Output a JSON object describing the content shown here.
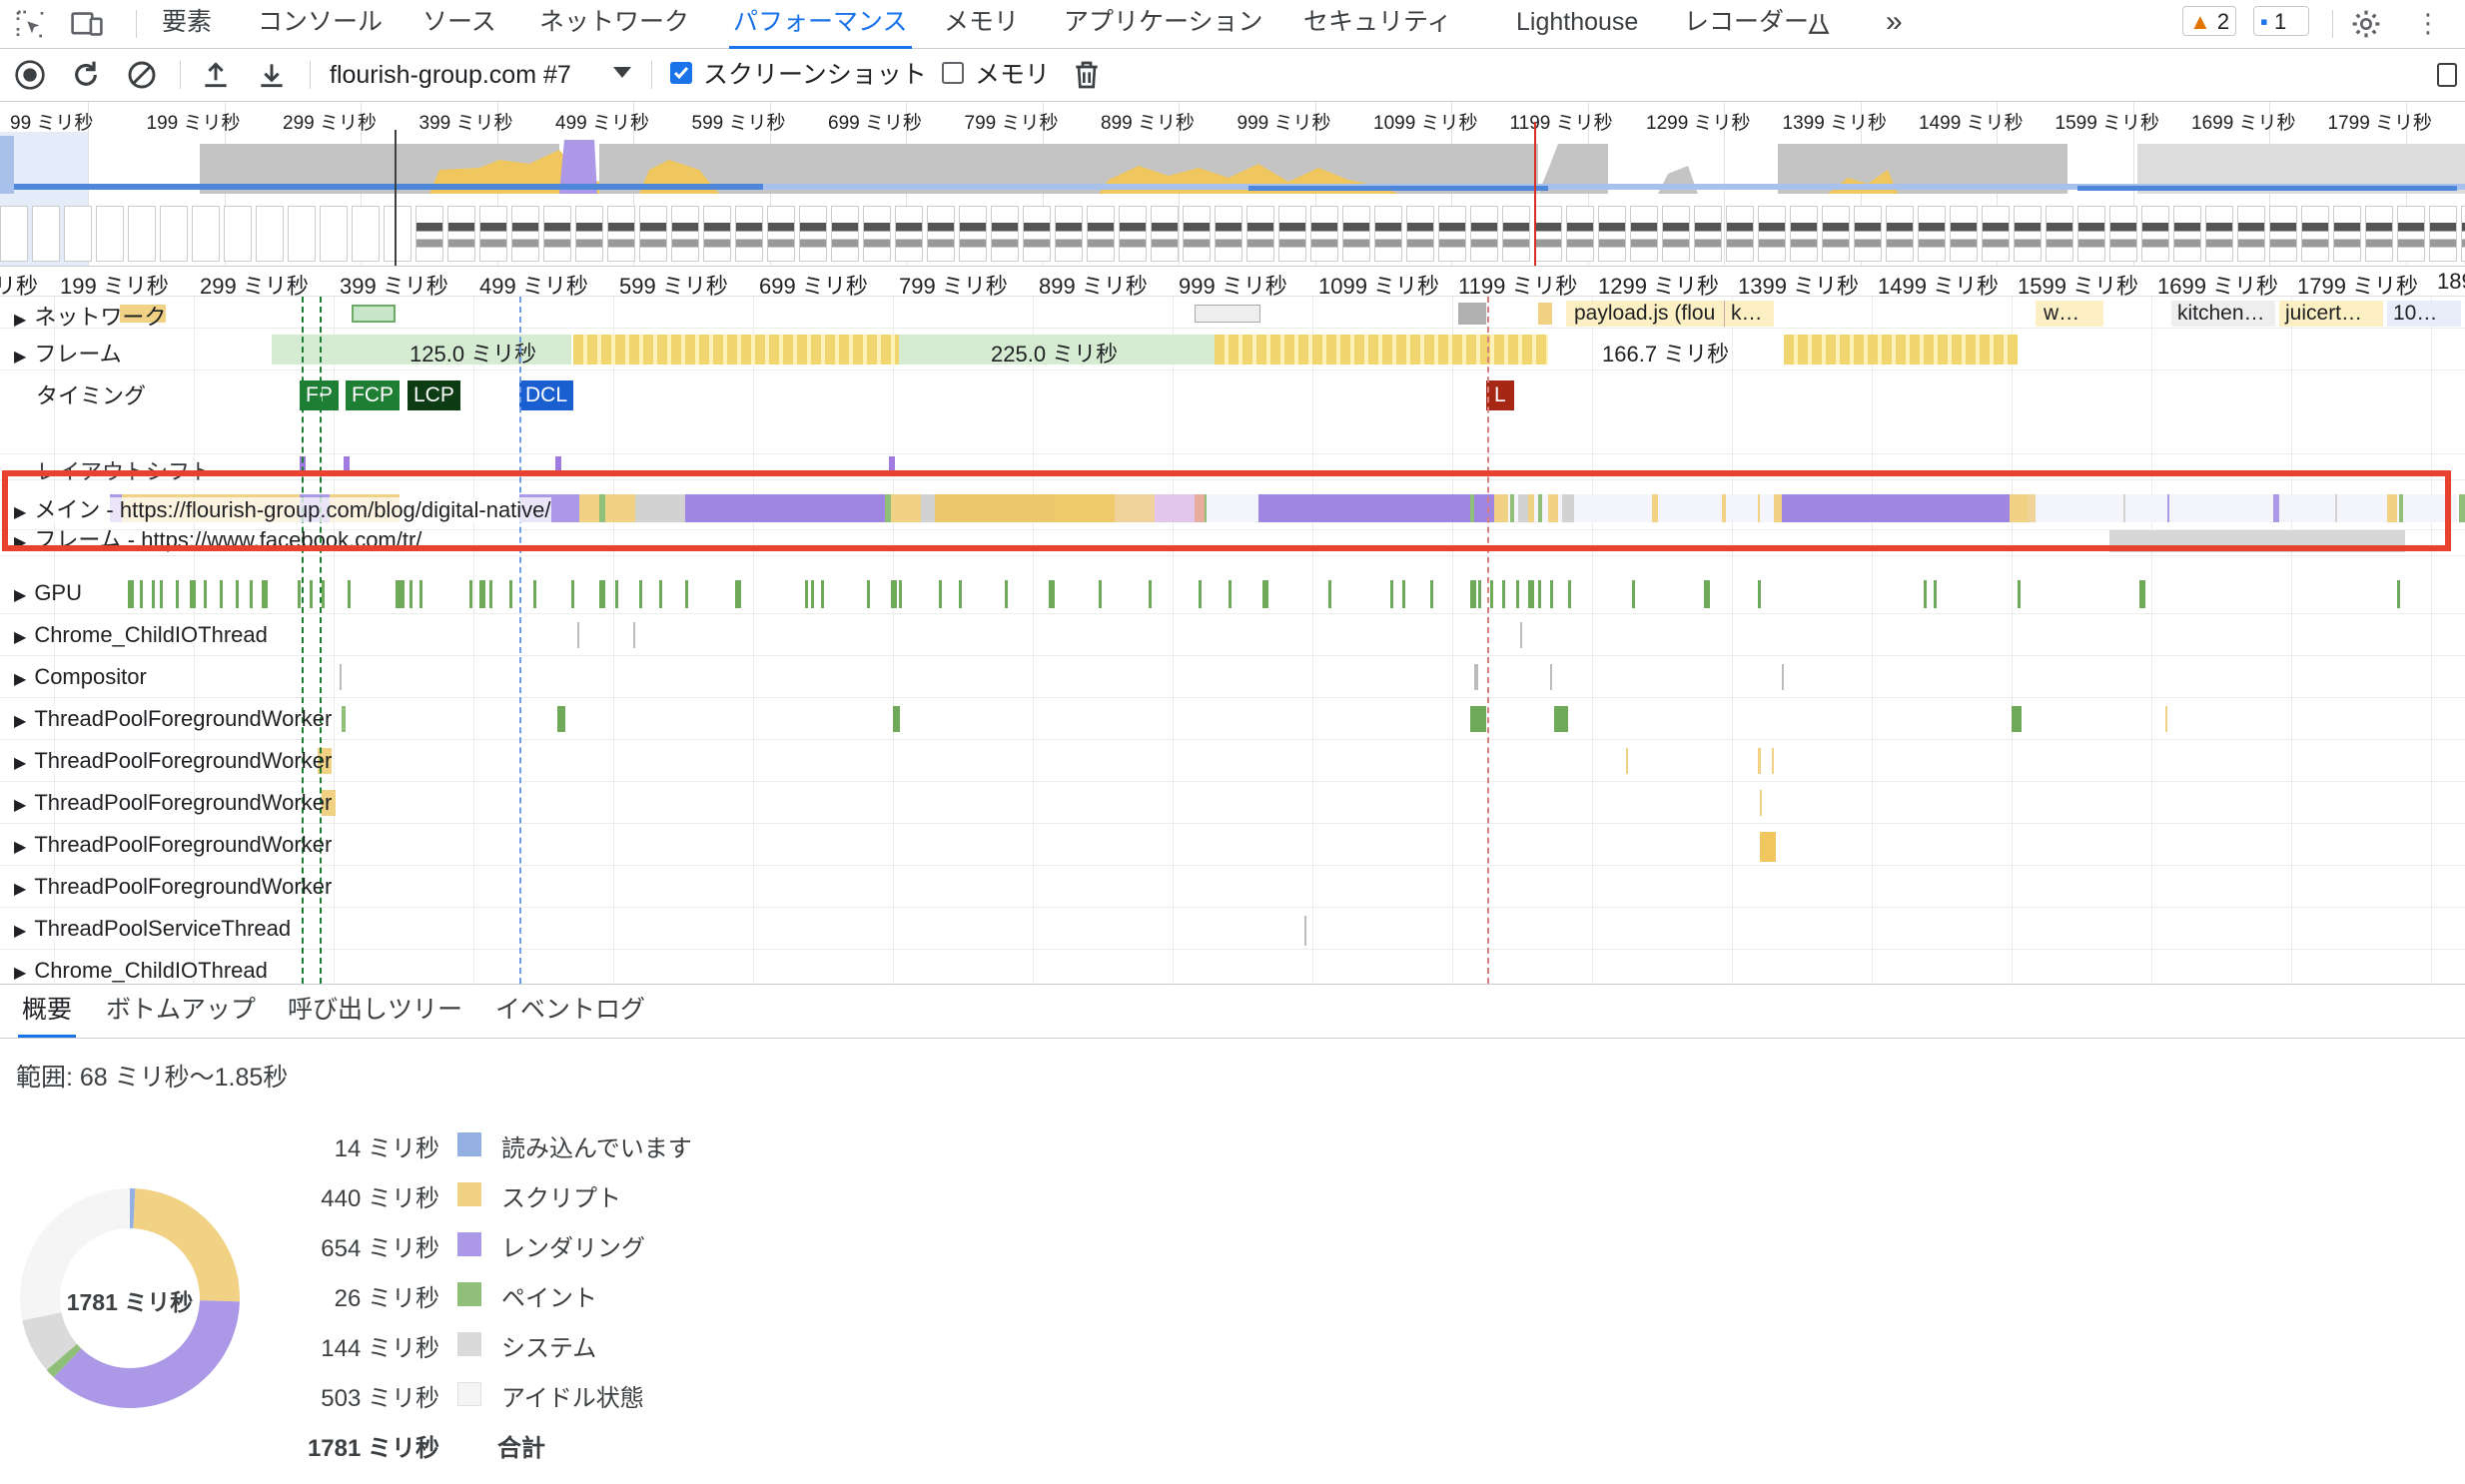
{
  "tabs": {
    "items": [
      "要素",
      "コンソール",
      "ソース",
      "ネットワーク",
      "パフォーマンス",
      "メモリ",
      "アプリケーション",
      "セキュリティ",
      "Lighthouse",
      "レコーダー",
      "»"
    ],
    "active_index": 4,
    "warnings": "2",
    "messages": "1"
  },
  "toolbar": {
    "profile": "flourish-group.com #7",
    "screenshot_label": "スクリーンショット",
    "screenshot_checked": true,
    "memory_label": "メモリ",
    "memory_checked": false
  },
  "overview": {
    "ticks": [
      "99 ミリ秒",
      "199 ミリ秒",
      "299 ミリ秒",
      "399 ミリ秒",
      "499 ミリ秒",
      "599 ミリ秒",
      "699 ミリ秒",
      "799 ミリ秒",
      "899 ミリ秒",
      "999 ミリ秒",
      "1099 ミリ秒",
      "1199 ミリ秒",
      "1299 ミリ秒",
      "1399 ミリ秒",
      "1499 ミリ秒",
      "1599 ミリ秒",
      "1699 ミリ秒",
      "1799 ミリ秒"
    ]
  },
  "ruler": {
    "ticks": [
      "リ秒",
      "199 ミリ秒",
      "299 ミリ秒",
      "399 ミリ秒",
      "499 ミリ秒",
      "599 ミリ秒",
      "699 ミリ秒",
      "799 ミリ秒",
      "899 ミリ秒",
      "999 ミリ秒",
      "1099 ミリ秒",
      "1199 ミリ秒",
      "1299 ミリ秒",
      "1399 ミリ秒",
      "1499 ミリ秒",
      "1599 ミリ秒",
      "1699 ミリ秒",
      "1799 ミリ秒",
      "189"
    ]
  },
  "tracks": {
    "network": "ネットワーク",
    "frames": "フレーム",
    "timings": "タイミング",
    "layout_shifts": "レイアウトシフト",
    "main": "メイン - https://flourish-group.com/blog/digital-native/",
    "fb_frame": "フレーム - https://www.facebook.com/tr/",
    "gpu": "GPU",
    "child_io_1": "Chrome_ChildIOThread",
    "compositor": "Compositor",
    "pool_1": "ThreadPoolForegroundWorker",
    "pool_2": "ThreadPoolForegroundWorker",
    "pool_3": "ThreadPoolForegroundWorker",
    "pool_4": "ThreadPoolForegroundWorker",
    "pool_5": "ThreadPoolForegroundWorker",
    "pool_service": "ThreadPoolServiceThread",
    "child_io_2": "Chrome_ChildIOThread"
  },
  "frames": {
    "f1": "125.0 ミリ秒",
    "f2": "225.0 ミリ秒",
    "f3": "166.7 ミリ秒"
  },
  "network_requests": {
    "r1": "payload.js (flou",
    "r2": "k…",
    "r3": "w…",
    "r4": "kitchen…",
    "r5": "juicert…",
    "r6": "10…"
  },
  "timing_markers": {
    "fp": "FP",
    "fcp": "FCP",
    "lcp": "LCP",
    "dcl": "DCL",
    "l": "L"
  },
  "bottom_tabs": {
    "items": [
      "概要",
      "ボトムアップ",
      "呼び出しツリー",
      "イベントログ"
    ],
    "active_index": 0
  },
  "summary": {
    "range": "範囲: 68 ミリ秒〜1.85秒",
    "total_center": "1781 ミリ秒",
    "rows": [
      {
        "value": "14 ミリ秒",
        "label": "読み込んでいます",
        "color": "#94b0e3",
        "ms": 14
      },
      {
        "value": "440 ミリ秒",
        "label": "スクリプト",
        "color": "#f1d183",
        "ms": 440
      },
      {
        "value": "654 ミリ秒",
        "label": "レンダリング",
        "color": "#ab98e6",
        "ms": 654
      },
      {
        "value": "26 ミリ秒",
        "label": "ペイント",
        "color": "#8fbf79",
        "ms": 26
      },
      {
        "value": "144 ミリ秒",
        "label": "システム",
        "color": "#dadada",
        "ms": 144
      },
      {
        "value": "503 ミリ秒",
        "label": "アイドル状態",
        "color": "#f5f5f5",
        "ms": 503
      }
    ],
    "total_value": "1781 ミリ秒",
    "total_label": "合計"
  },
  "colors": {
    "accent": "#1a73e8",
    "highlight": "#e8412f",
    "scripting": "#f1d183",
    "rendering": "#ab98e6",
    "painting": "#8fbf79",
    "system": "#dadada",
    "loading": "#94b0e3"
  }
}
